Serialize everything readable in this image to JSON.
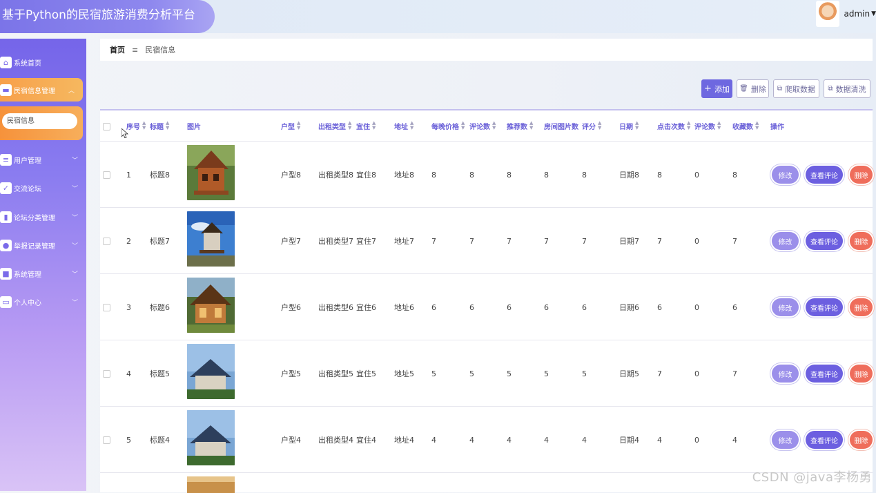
{
  "app": {
    "title": "基于Python的民宿旅游消费分析平台"
  },
  "user": {
    "name": "admin"
  },
  "sidebar": {
    "items": [
      {
        "label": "系统首页",
        "icon": "home-icon"
      },
      {
        "label": "民宿信息管理",
        "icon": "monitor-icon",
        "active": true
      },
      {
        "label": "用户管理",
        "icon": "sliders-icon"
      },
      {
        "label": "交流论坛",
        "icon": "check-icon"
      },
      {
        "label": "论坛分类管理",
        "icon": "book-icon"
      },
      {
        "label": "举报记录管理",
        "icon": "bulb-icon"
      },
      {
        "label": "系统管理",
        "icon": "briefcase-icon"
      },
      {
        "label": "个人中心",
        "icon": "card-icon"
      }
    ],
    "submenu": {
      "label": "民宿信息"
    }
  },
  "breadcrumb": {
    "home": "首页",
    "separator": "≡",
    "current": "民宿信息"
  },
  "toolbar": {
    "add": "添加",
    "delete": "删除",
    "crawl": "爬取数据",
    "clean": "数据清洗"
  },
  "table": {
    "headers": [
      "序号",
      "标题",
      "图片",
      "户型",
      "出租类型",
      "宜住",
      "地址",
      "每晚价格",
      "评论数",
      "推荐数",
      "房间图片数",
      "评分",
      "日期",
      "点击次数",
      "评论数",
      "收藏数",
      "操作"
    ],
    "actions": {
      "edit": "修改",
      "reviews": "查看评论",
      "delete": "删除"
    },
    "rows": [
      {
        "index": "1",
        "title": "标题8",
        "room_type": "户型8",
        "rent_type": "出租类型8",
        "suitable": "宜住8",
        "address": "地址8",
        "price": "8",
        "comments": "8",
        "recommend": "8",
        "room_images": "8",
        "score": "8",
        "date": "日期8",
        "clicks": "8",
        "reviews": "0",
        "favorites": "8"
      },
      {
        "index": "2",
        "title": "标题7",
        "room_type": "户型7",
        "rent_type": "出租类型7",
        "suitable": "宜住7",
        "address": "地址7",
        "price": "7",
        "comments": "7",
        "recommend": "7",
        "room_images": "7",
        "score": "7",
        "date": "日期7",
        "clicks": "7",
        "reviews": "0",
        "favorites": "7"
      },
      {
        "index": "3",
        "title": "标题6",
        "room_type": "户型6",
        "rent_type": "出租类型6",
        "suitable": "宜住6",
        "address": "地址6",
        "price": "6",
        "comments": "6",
        "recommend": "6",
        "room_images": "6",
        "score": "6",
        "date": "日期6",
        "clicks": "6",
        "reviews": "0",
        "favorites": "6"
      },
      {
        "index": "4",
        "title": "标题5",
        "room_type": "户型5",
        "rent_type": "出租类型5",
        "suitable": "宜住5",
        "address": "地址5",
        "price": "5",
        "comments": "5",
        "recommend": "5",
        "room_images": "5",
        "score": "5",
        "date": "日期5",
        "clicks": "7",
        "reviews": "0",
        "favorites": "7"
      },
      {
        "index": "5",
        "title": "标题4",
        "room_type": "户型4",
        "rent_type": "出租类型4",
        "suitable": "宜住4",
        "address": "地址4",
        "price": "4",
        "comments": "4",
        "recommend": "4",
        "room_images": "4",
        "score": "4",
        "date": "日期4",
        "clicks": "4",
        "reviews": "0",
        "favorites": "4"
      }
    ]
  },
  "watermark": "CSDN @java李杨勇"
}
